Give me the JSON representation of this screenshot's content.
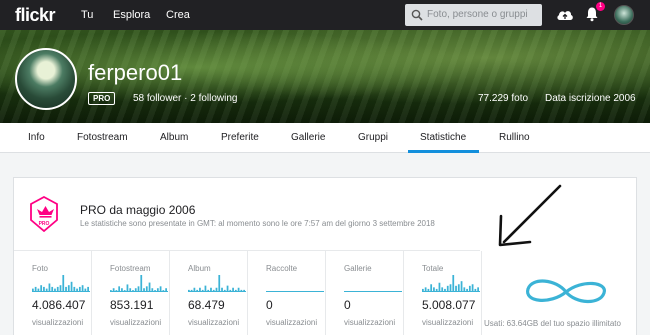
{
  "topnav": {
    "logo": "flickr",
    "links": [
      "Tu",
      "Esplora",
      "Crea"
    ],
    "search_placeholder": "Foto, persone o gruppi",
    "notification_count": "1"
  },
  "profile": {
    "username": "ferpero01",
    "pro_label": "PRO",
    "followers": "58 follower · 2 following",
    "photos": "77.229 foto",
    "joined": "Data iscrizione 2006"
  },
  "tabs": [
    "Info",
    "Fotostream",
    "Album",
    "Preferite",
    "Gallerie",
    "Gruppi",
    "Statistiche",
    "Rullino"
  ],
  "active_tab": "Statistiche",
  "stats": {
    "pro_since": "PRO da maggio 2006",
    "note": "Le statistiche sono presentate in GMT: al momento sono le ore 7:57 am del giorno 3 settembre 2018",
    "columns": [
      {
        "label": "Foto",
        "value": "4.086.407",
        "unit": "visualizzazioni",
        "spark": [
          2,
          3,
          2,
          4,
          3,
          2,
          5,
          3,
          2,
          3,
          4,
          10,
          3,
          4,
          6,
          3,
          2,
          3,
          4,
          2,
          3
        ]
      },
      {
        "label": "Fotostream",
        "value": "853.191",
        "unit": "visualizzazioni",
        "spark": [
          1,
          2,
          1,
          3,
          2,
          1,
          4,
          2,
          1,
          2,
          3,
          9,
          2,
          3,
          5,
          2,
          1,
          2,
          3,
          1,
          2
        ]
      },
      {
        "label": "Album",
        "value": "68.479",
        "unit": "visualizzazioni",
        "spark": [
          1,
          1,
          2,
          1,
          2,
          1,
          3,
          1,
          2,
          1,
          2,
          8,
          2,
          1,
          3,
          1,
          2,
          1,
          2,
          1,
          1
        ]
      },
      {
        "label": "Raccolte",
        "value": "0",
        "unit": "visualizzazioni",
        "spark": []
      },
      {
        "label": "Gallerie",
        "value": "0",
        "unit": "visualizzazioni",
        "spark": []
      },
      {
        "label": "Totale",
        "value": "5.008.077",
        "unit": "visualizzazioni",
        "spark": [
          2,
          3,
          2,
          5,
          3,
          2,
          6,
          3,
          2,
          4,
          5,
          11,
          4,
          5,
          7,
          3,
          2,
          4,
          5,
          2,
          3
        ]
      }
    ],
    "storage": "Usati: 63.64GB del tuo spazio illimitato"
  },
  "colors": {
    "topbar": "#212124",
    "accent": "#128fdc",
    "pro_pink": "#ff0084",
    "spark": "#3bb3d6",
    "infinity": "#3bb3d6"
  }
}
